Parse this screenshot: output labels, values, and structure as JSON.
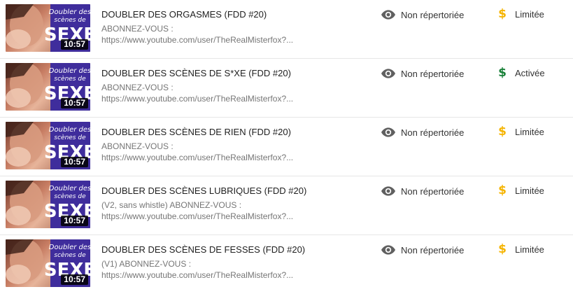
{
  "colors": {
    "limited": "#f5b400",
    "enabled": "#188038",
    "eye": "#606060"
  },
  "videos": [
    {
      "title": "DOUBLER DES ORGASMES (FDD #20)",
      "desc_line1": "ABONNEZ-VOUS :",
      "desc_line2": "https://www.youtube.com/user/TheRealMisterfox?...",
      "duration": "10:57",
      "visibility": "Non répertoriée",
      "visibility_icon": "eye-icon",
      "monetization": "Limitée",
      "monetization_icon": "dollar-icon",
      "monetization_status": "limited",
      "thumb_text": [
        "Doubler des",
        "scènes de",
        "SEXE"
      ]
    },
    {
      "title": "DOUBLER DES SCÈNES DE S*XE (FDD #20)",
      "desc_line1": "ABONNEZ-VOUS :",
      "desc_line2": "https://www.youtube.com/user/TheRealMisterfox?...",
      "duration": "10:57",
      "visibility": "Non répertoriée",
      "visibility_icon": "eye-icon",
      "monetization": "Activée",
      "monetization_icon": "dollar-icon",
      "monetization_status": "enabled",
      "thumb_text": [
        "Doubler des",
        "scènes de",
        "SEXE"
      ]
    },
    {
      "title": "DOUBLER DES SCÈNES DE RIEN (FDD #20)",
      "desc_line1": "ABONNEZ-VOUS :",
      "desc_line2": "https://www.youtube.com/user/TheRealMisterfox?...",
      "duration": "10:57",
      "visibility": "Non répertoriée",
      "visibility_icon": "eye-icon",
      "monetization": "Limitée",
      "monetization_icon": "dollar-icon",
      "monetization_status": "limited",
      "thumb_text": [
        "Doubler des",
        "scènes de",
        "SEXE"
      ]
    },
    {
      "title": "DOUBLER DES SCÈNES LUBRIQUES (FDD #20)",
      "desc_line1": "(V2, sans whistle) ABONNEZ-VOUS :",
      "desc_line2": "https://www.youtube.com/user/TheRealMisterfox?...",
      "duration": "10:57",
      "visibility": "Non répertoriée",
      "visibility_icon": "eye-icon",
      "monetization": "Limitée",
      "monetization_icon": "dollar-icon",
      "monetization_status": "limited",
      "thumb_text": [
        "Doubler des",
        "scènes de",
        "SEXE"
      ]
    },
    {
      "title": "DOUBLER DES SCÈNES DE FESSES (FDD #20)",
      "desc_line1": "(V1) ABONNEZ-VOUS :",
      "desc_line2": "https://www.youtube.com/user/TheRealMisterfox?...",
      "duration": "10:57",
      "visibility": "Non répertoriée",
      "visibility_icon": "eye-icon",
      "monetization": "Limitée",
      "monetization_icon": "dollar-icon",
      "monetization_status": "limited",
      "thumb_text": [
        "Doubler des",
        "scènes de",
        "SEXE"
      ]
    }
  ]
}
